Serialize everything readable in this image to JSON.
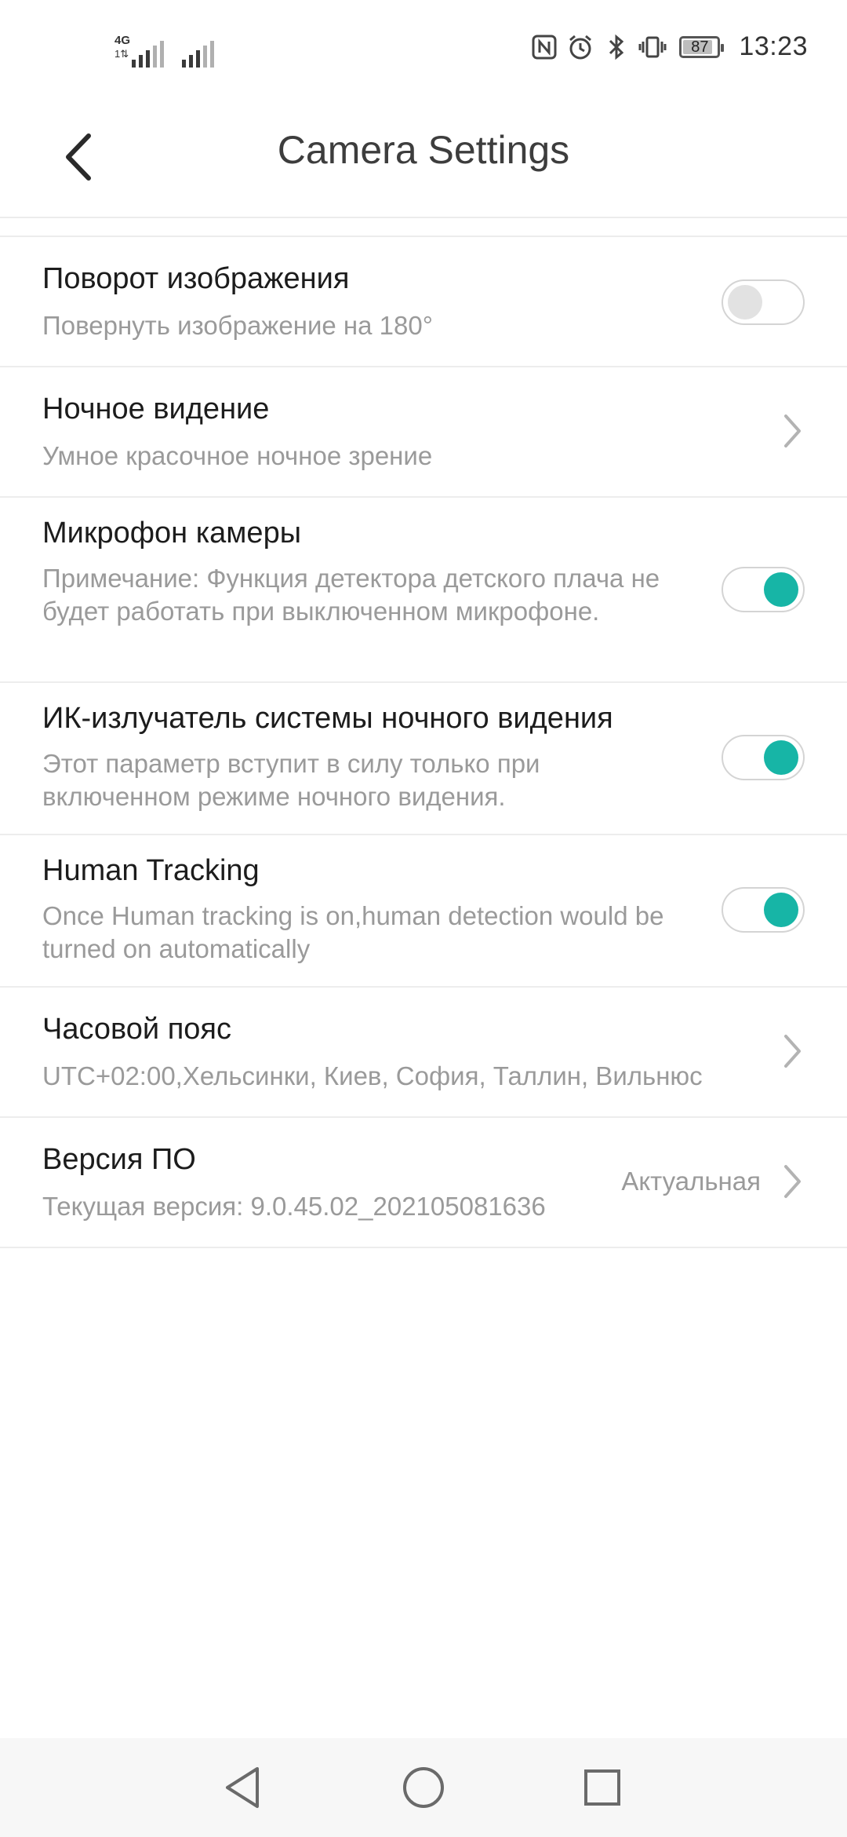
{
  "status_bar": {
    "sim1_network": "4G",
    "sim1_sub": "1⇅",
    "battery_level": 87,
    "battery_text": "87",
    "time": "13:23",
    "icons": [
      "nfc-icon",
      "alarm-icon",
      "bluetooth-icon",
      "vibrate-icon"
    ]
  },
  "header": {
    "title": "Camera Settings",
    "back_icon": "back-arrow-icon"
  },
  "settings": {
    "image_rotation": {
      "title": "Поворот изображения",
      "subtitle": "Повернуть изображение на 180°",
      "enabled": false
    },
    "night_vision": {
      "title": "Ночное видение",
      "subtitle": "Умное красочное ночное зрение"
    },
    "microphone": {
      "title": "Микрофон камеры",
      "subtitle": "Примечание: Функция детектора детского плача не будет работать при выключенном микрофоне.",
      "enabled": true
    },
    "ir_emitter": {
      "title": "ИК-излучатель системы ночного видения",
      "subtitle": "Этот параметр вступит в силу только при включенном режиме ночного видения.",
      "enabled": true
    },
    "human_tracking": {
      "title": "Human Tracking",
      "subtitle": "Once Human tracking is on,human detection would be turned on automatically",
      "enabled": true
    },
    "time_zone": {
      "title": "Часовой пояс",
      "subtitle": "UTC+02:00,Хельсинки, Киев, София, Таллин, Вильнюс"
    },
    "firmware": {
      "title": "Версия ПО",
      "subtitle": "Текущая версия: 9.0.45.02_202105081636",
      "value": "Актуальная"
    }
  },
  "colors": {
    "accent": "#17b5a6",
    "title_text": "#1c1c1c",
    "sub_text": "#9a9a9a",
    "divider": "#ededed"
  },
  "nav_bar": {
    "icons": [
      "back-triangle-icon",
      "home-circle-icon",
      "recents-square-icon"
    ]
  }
}
